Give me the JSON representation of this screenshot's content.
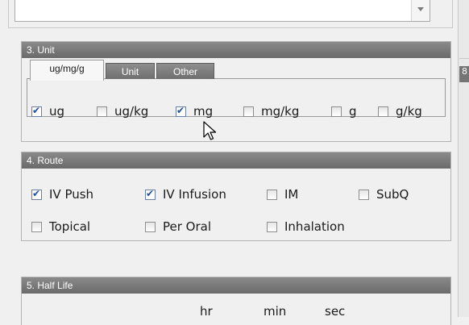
{
  "sections": {
    "unit": {
      "title": "3. Unit",
      "tabs": [
        {
          "label": "ug/mg/g",
          "active": true
        },
        {
          "label": "Unit",
          "active": false
        },
        {
          "label": "Other",
          "active": false
        }
      ],
      "options": [
        {
          "label": "ug",
          "checked": true
        },
        {
          "label": "ug/kg",
          "checked": false
        },
        {
          "label": "mg",
          "checked": true
        },
        {
          "label": "mg/kg",
          "checked": false
        },
        {
          "label": "g",
          "checked": false
        },
        {
          "label": "g/kg",
          "checked": false
        }
      ]
    },
    "route": {
      "title": "4. Route",
      "options": [
        {
          "label": "IV Push",
          "checked": true
        },
        {
          "label": "IV Infusion",
          "checked": true
        },
        {
          "label": "IM",
          "checked": false
        },
        {
          "label": "SubQ",
          "checked": false
        },
        {
          "label": "Topical",
          "checked": false
        },
        {
          "label": "Per Oral",
          "checked": false
        },
        {
          "label": "Inhalation",
          "checked": false
        }
      ]
    },
    "halflife": {
      "title": "5. Half Life",
      "columns": [
        "hr",
        "min",
        "sec"
      ]
    }
  },
  "right_panel": {
    "partial_tab_label": "8"
  },
  "icons": {
    "cursor": "mouse-pointer-icon",
    "dropdown": "chevron-down-icon",
    "checkmark": "checkmark-icon"
  }
}
